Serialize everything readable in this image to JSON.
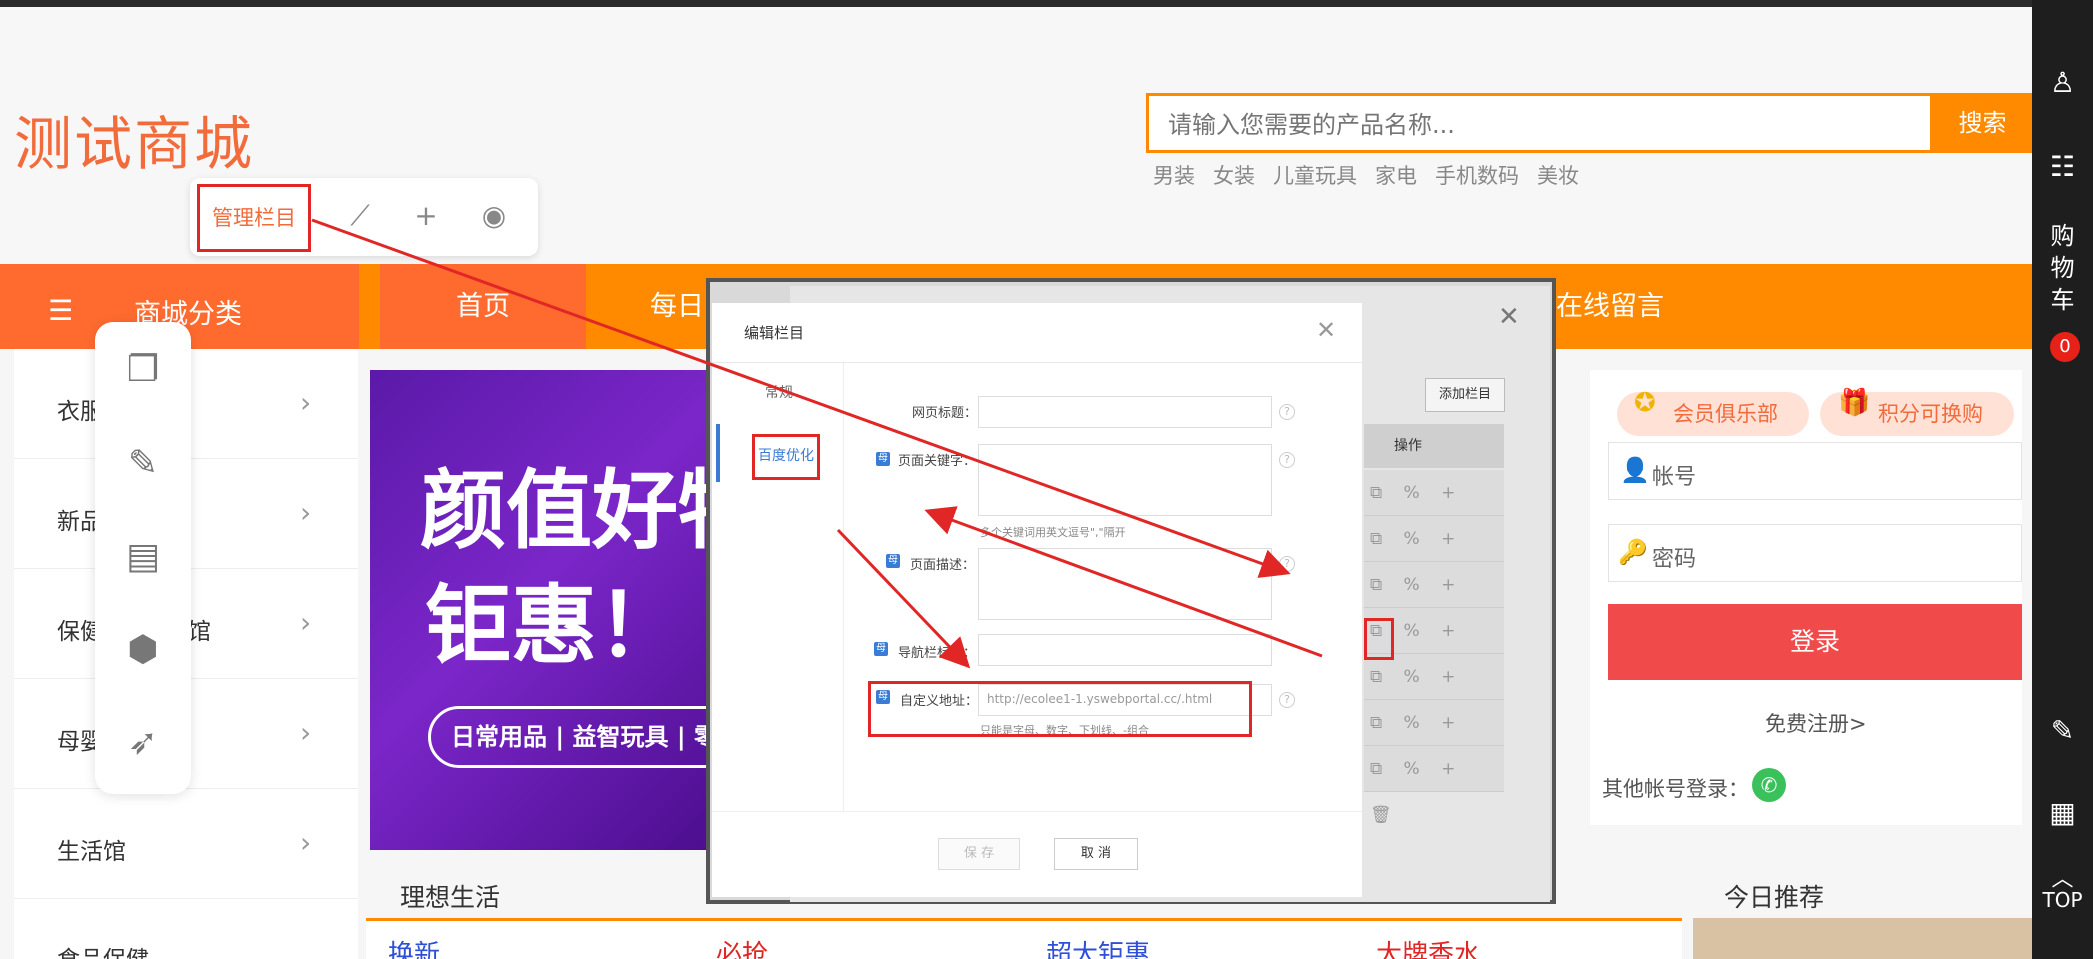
{
  "header": {
    "logo": "测试商城",
    "search_placeholder": "请输入您需要的产品名称...",
    "search_button": "搜索",
    "hotwords": [
      "男装",
      "女装",
      "儿童玩具",
      "家电",
      "手机数码",
      "美妆"
    ]
  },
  "manage_toolbar": {
    "manage_label": "管理栏目",
    "icons": [
      "magic-wand-icon",
      "plus-icon",
      "eye-icon"
    ]
  },
  "nav": {
    "category_label": "商城分类",
    "items": [
      "首页",
      "每日",
      "在线留言"
    ]
  },
  "sidebar": {
    "items": [
      "衣服",
      "新品",
      "保健",
      "母婴",
      "生活馆",
      "食品保健"
    ],
    "partial_text": "馆"
  },
  "banner": {
    "line1": "颜值好物",
    "line2": "钜惠！",
    "pill": "日常用品 | 益智玩具 | 零"
  },
  "login": {
    "club": "会员俱乐部",
    "points": "积分可换购",
    "account_placeholder": "帐号",
    "password_placeholder": "密码",
    "login_button": "登录",
    "register": "免费注册>",
    "other_login": "其他帐号登录："
  },
  "sections": {
    "ideal_life": "理想生活",
    "today_recommend": "今日推荐",
    "cards": [
      {
        "title": "换新",
        "color": "#2f4fd8"
      },
      {
        "title": "必抢",
        "color": "#e12626"
      },
      {
        "title": "超大钜惠",
        "color": "#2f4fd8"
      },
      {
        "title": "大牌香水",
        "color": "#e12626"
      }
    ]
  },
  "right_rail": {
    "cart_label": "购物车",
    "cart_count": "0",
    "top_label": "TOP"
  },
  "back_panel": {
    "add_button": "添加栏目",
    "column_header": "操作",
    "row_icons": "⧉ % + 🗑"
  },
  "dialog": {
    "title": "编辑栏目",
    "tab_general": "常规",
    "tab_seo": "百度优化",
    "fields": {
      "page_title": "网页标题：",
      "keywords": "页面关键字：",
      "keywords_note": "多个关键词用英文逗号\",\"隔开",
      "description": "页面描述：",
      "nav_title": "导航栏标题：",
      "custom_url": "自定义地址：",
      "custom_url_value": "http://ecolee1-1.yswebportal.cc/.html",
      "custom_url_note": "只能是字母、数字、下划线、-组合"
    },
    "badge_char": "母",
    "save": "保 存",
    "cancel": "取 消"
  },
  "colors": {
    "brand_orange": "#ff8a00",
    "accent_red": "#e12626",
    "logo": "#f26b3a"
  }
}
